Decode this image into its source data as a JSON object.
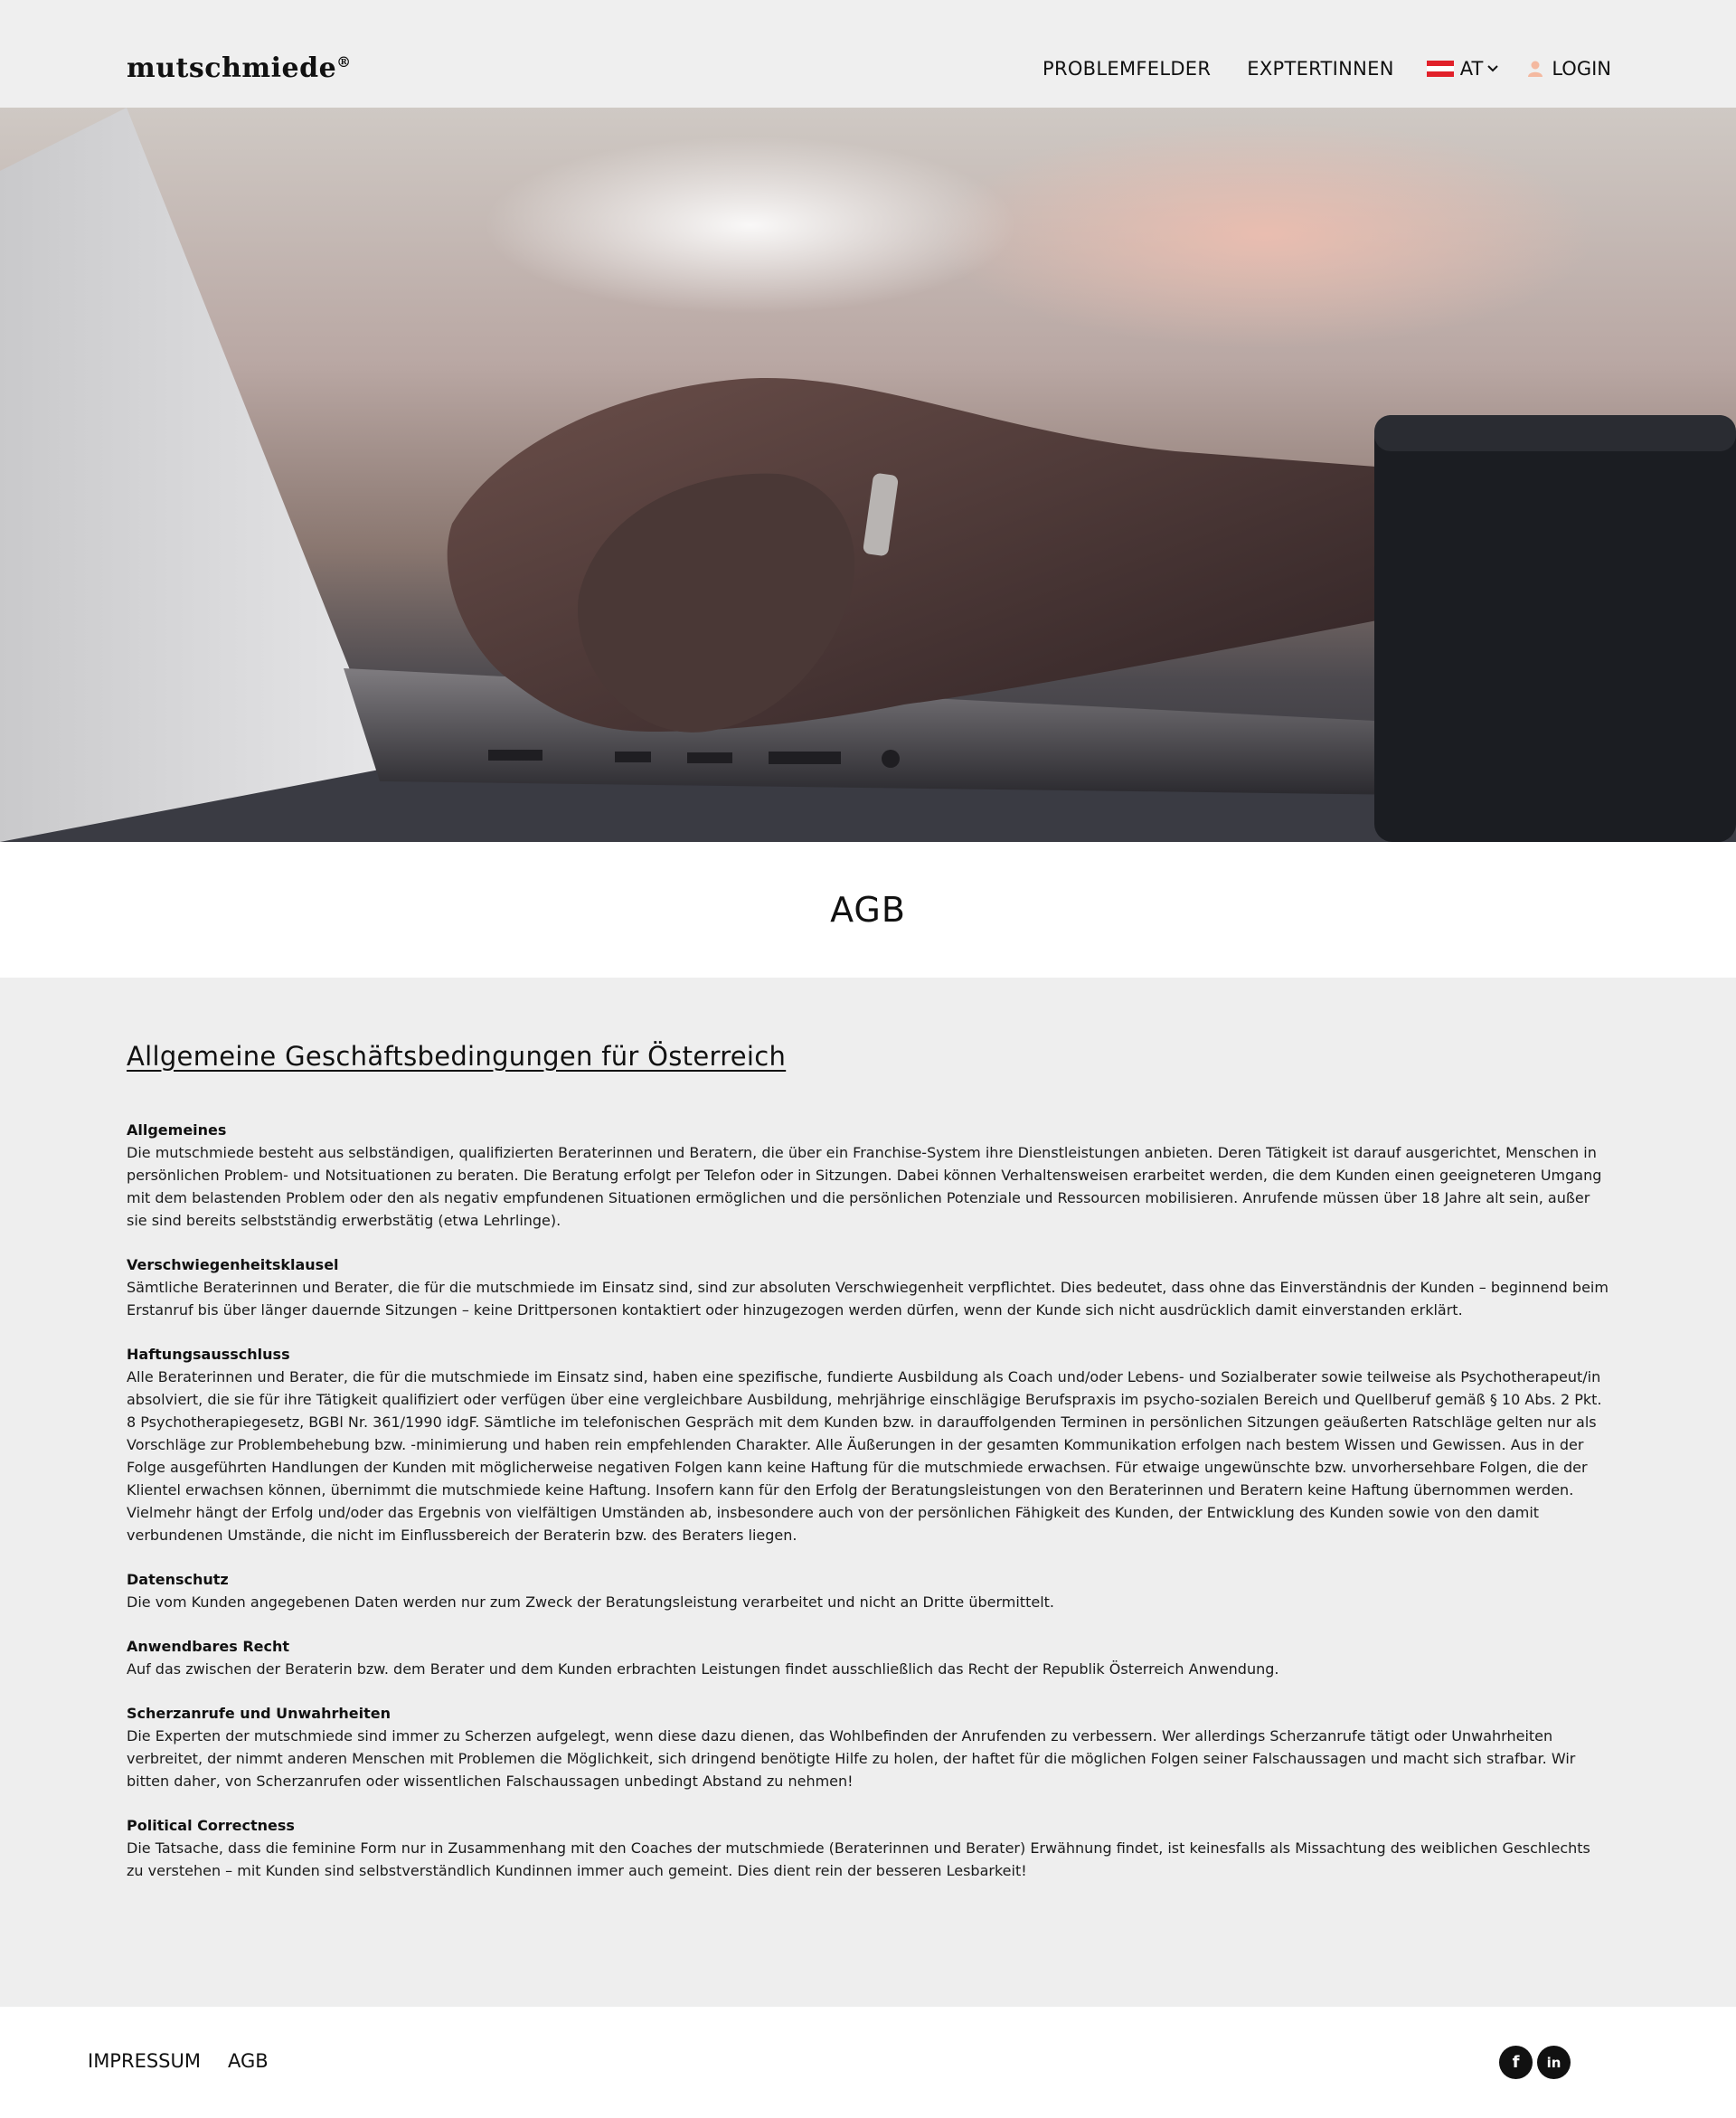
{
  "header": {
    "logo": "mutschmiede",
    "logo_mark": "®",
    "nav": [
      "PROBLEMFELDER",
      "EXPTERTINNEN"
    ],
    "language": "AT",
    "login": "LOGIN"
  },
  "page_title": "AGB",
  "content": {
    "heading": "Allgemeine Geschäftsbedingungen für Österreich",
    "sections": [
      {
        "title": "Allgemeines",
        "text": "Die mutschmiede besteht aus selbständigen, qualifizierten Beraterinnen und Beratern, die über ein Franchise-System ihre Dienstleistungen anbieten. Deren Tätigkeit ist darauf ausgerichtet, Menschen in persönlichen Problem- und Notsituationen zu beraten. Die Beratung erfolgt per Telefon oder in Sitzungen. Dabei können Verhaltensweisen erarbeitet werden, die dem Kunden einen geeigneteren Umgang mit dem belastenden Problem oder den als negativ empfundenen Situationen ermöglichen und die persönlichen Potenziale und Ressourcen mobilisieren. Anrufende müssen über 18 Jahre alt sein, außer sie sind bereits selbstständig erwerbstätig (etwa Lehrlinge)."
      },
      {
        "title": "Verschwiegenheitsklausel",
        "text": "Sämtliche Beraterinnen und Berater, die für die mutschmiede im Einsatz sind, sind zur absoluten Verschwiegenheit verpflichtet. Dies bedeutet, dass ohne das Einverständnis der Kunden – beginnend beim Erstanruf bis über länger dauernde Sitzungen – keine Drittpersonen kontaktiert oder hinzugezogen werden dürfen, wenn der Kunde sich nicht ausdrücklich damit einverstanden erklärt."
      },
      {
        "title": "Haftungsausschluss",
        "text": "Alle Beraterinnen und Berater, die für die mutschmiede im Einsatz sind, haben eine spezifische, fundierte Ausbildung als Coach und/oder Lebens- und Sozialberater sowie teilweise als Psychotherapeut/in absolviert, die sie für ihre Tätigkeit qualifiziert oder verfügen über eine vergleichbare Ausbildung, mehrjährige einschlägige Berufspraxis im psycho-sozialen Bereich und Quellberuf gemäß § 10 Abs. 2 Pkt. 8 Psychotherapiegesetz, BGBl Nr. 361/1990 idgF. Sämtliche im telefonischen Gespräch mit dem Kunden bzw. in darauffolgenden Terminen in persönlichen Sitzungen geäußerten Ratschläge gelten nur als Vorschläge zur Problembehebung bzw. -minimierung und haben rein empfehlenden Charakter. Alle Äußerungen in der gesamten Kommunikation erfolgen nach bestem Wissen und Gewissen. Aus in der Folge ausgeführten Handlungen der Kunden mit möglicherweise negativen Folgen kann keine Haftung für die mutschmiede erwachsen. Für etwaige ungewünschte bzw. unvorhersehbare Folgen, die der Klientel erwachsen können, übernimmt die mutschmiede keine Haftung. Insofern kann für den Erfolg der Beratungsleistungen von den Beraterinnen und Beratern keine Haftung übernommen werden. Vielmehr hängt der Erfolg und/oder das Ergebnis von vielfältigen Umständen ab, insbesondere auch von der persönlichen Fähigkeit des Kunden, der Entwicklung des Kunden sowie von den damit verbundenen Umstände, die nicht im Einflussbereich der Beraterin bzw. des Beraters liegen."
      },
      {
        "title": "Datenschutz",
        "text": "Die vom Kunden angegebenen Daten werden nur zum Zweck der Beratungsleistung verarbeitet und nicht an Dritte übermittelt."
      },
      {
        "title": "Anwendbares Recht",
        "text": "Auf das zwischen der Beraterin bzw. dem Berater und dem Kunden erbrachten Leistungen findet ausschließlich das Recht der Republik Österreich Anwendung."
      },
      {
        "title": "Scherzanrufe und Unwahrheiten",
        "text": "Die Experten der mutschmiede sind immer zu Scherzen aufgelegt, wenn diese dazu dienen, das Wohlbefinden der Anrufenden zu verbessern. Wer allerdings Scherzanrufe tätigt oder Unwahrheiten verbreitet, der nimmt anderen Menschen mit Problemen die Möglichkeit, sich dringend benötigte Hilfe zu holen, der haftet für die möglichen Folgen seiner Falschaussagen und macht sich strafbar. Wir bitten daher, von Scherzanrufen oder wissentlichen Falschaussagen unbedingt Abstand zu nehmen!"
      },
      {
        "title": "Political Correctness",
        "text": "Die Tatsache, dass die feminine Form nur in Zusammenhang mit den Coaches der mutschmiede (Beraterinnen und Berater) Erwähnung findet, ist keinesfalls als Missachtung des weiblichen Geschlechts zu verstehen – mit Kunden sind selbstverständlich Kundinnen immer auch gemeint. Dies dient rein der besseren Lesbarkeit!"
      }
    ]
  },
  "footer": {
    "links": [
      "IMPRESSUM",
      "AGB"
    ],
    "social": [
      {
        "icon": "facebook-icon",
        "glyph": "f"
      },
      {
        "icon": "linkedin-icon",
        "glyph": "in"
      }
    ]
  },
  "colors": {
    "background": "#efefef",
    "flag_red": "#e1212a",
    "user_icon": "#f4b9a0",
    "text": "#111111"
  }
}
